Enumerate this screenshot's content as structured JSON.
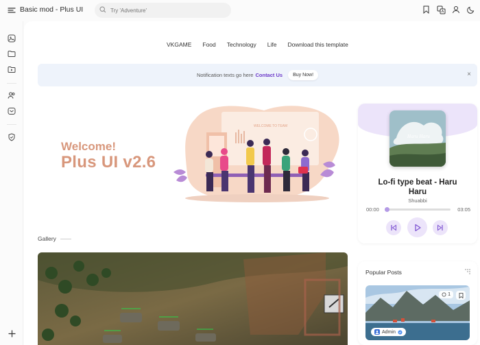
{
  "header": {
    "title": "Basic mod - Plus UI",
    "search_placeholder": "Try 'Adventure'"
  },
  "nav": {
    "links": [
      "VKGAME",
      "Food",
      "Technology",
      "Life",
      "Download this template"
    ]
  },
  "notification": {
    "text": "Notification texts go here",
    "link": "Contact Us",
    "button": "Buy Now!",
    "close": "×"
  },
  "hero": {
    "welcome": "Welcome!",
    "version": "Plus UI v2.6",
    "illustration_caption": "WELCOME TO TEAM"
  },
  "gallery": {
    "label": "Gallery"
  },
  "player": {
    "album_text": "Haru Haru",
    "song_title": "Lo-fi type beat - Haru Haru",
    "artist": "Shuabbi",
    "time_current": "00:00",
    "time_total": "03:05",
    "progress": 0.0
  },
  "popular": {
    "title": "Popular Posts",
    "comments": "1",
    "author": "Admin"
  },
  "colors": {
    "accent": "#6b38c9",
    "hero_text": "#d8977c",
    "player_tint": "#ece4fa",
    "notif_bg": "#eef3fb"
  }
}
